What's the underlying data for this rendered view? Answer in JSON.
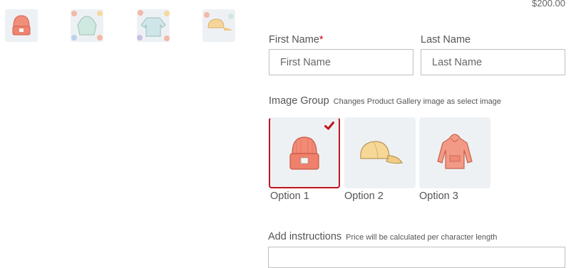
{
  "price": "$200.00",
  "gallery": {
    "thumbnails": [
      {
        "icon": "beanie-icon"
      },
      {
        "icon": "hoodie-pattern-icon"
      },
      {
        "icon": "sweatshirt-pattern-icon"
      },
      {
        "icon": "cap-pattern-icon"
      }
    ]
  },
  "form": {
    "first_name": {
      "label": "First Name",
      "required_mark": "*",
      "placeholder": "First Name",
      "value": ""
    },
    "last_name": {
      "label": "Last Name",
      "placeholder": "Last Name",
      "value": ""
    }
  },
  "image_group": {
    "label": "Image Group",
    "hint": "Changes Product Gallery image as select image",
    "options": [
      {
        "label": "Option 1",
        "icon": "beanie-icon",
        "selected": true
      },
      {
        "label": "Option 2",
        "icon": "cap-icon",
        "selected": false
      },
      {
        "label": "Option 3",
        "icon": "hoodie-icon",
        "selected": false
      }
    ]
  },
  "instructions": {
    "label": "Add instructions",
    "hint": "Price will be calculated per character length"
  },
  "colors": {
    "accent": "#c0151f",
    "tile_bg": "#eef1f4",
    "border": "#bfbfbf"
  }
}
